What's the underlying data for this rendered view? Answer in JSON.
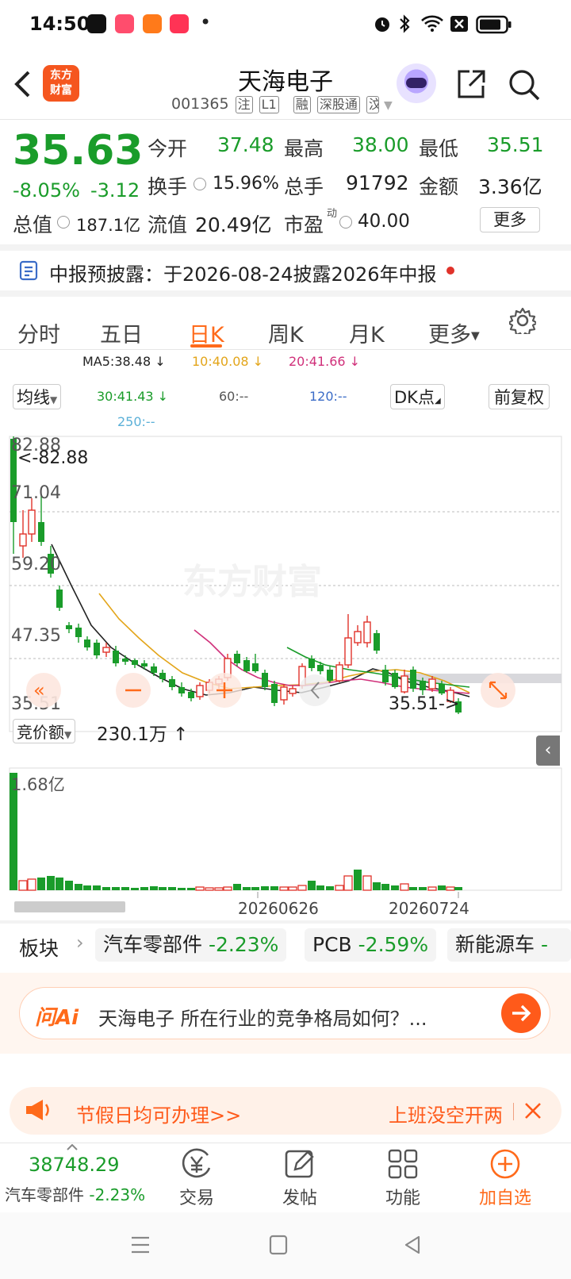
{
  "status_bar": {
    "time": "14:50",
    "dot": "•"
  },
  "header": {
    "title": "天海电子",
    "code": "001365",
    "tags": [
      "注",
      "L1",
      "融",
      "深股通",
      "汶"
    ]
  },
  "brand_logo": {
    "line1": "东方",
    "line2": "财富"
  },
  "quote": {
    "price": "35.63",
    "change_pct": "-8.05%",
    "change": "-3.12",
    "open_label": "今开",
    "open": "37.48",
    "high_label": "最高",
    "high": "38.00",
    "low_label": "最低",
    "low": "35.51",
    "turnover_label": "换手",
    "turnover": "15.96%",
    "volume_label": "总手",
    "volume": "91792",
    "amount_label": "金额",
    "amount": "3.36亿",
    "mktcap_label": "总值",
    "mktcap": "187.1亿",
    "float_label": "流值",
    "float_cap": "20.49亿",
    "pe_label": "市盈",
    "pe_sup": "动",
    "pe": "40.00",
    "more_label": "更多"
  },
  "notice": {
    "label": "中报预披露：",
    "text": "于2026-08-24披露2026年中报"
  },
  "tabs": [
    "分时",
    "五日",
    "日K",
    "周K",
    "月K",
    "更多"
  ],
  "active_tab": "日K",
  "ma_bar": {
    "ma_select": "均线",
    "ma5": "MA5:38.48 ↓",
    "ma10": "10:40.08 ↓",
    "ma20": "20:41.66 ↓",
    "ma30": "30:41.43 ↓",
    "ma60": "60:--",
    "ma120": "120:--",
    "ma250": "250:--",
    "dk_btn": "DK点",
    "fq_btn": "前复权"
  },
  "kline": {
    "y_max": "82.88",
    "y_2": "71.04",
    "y_3": "59.20",
    "y_4": "47.35",
    "y_min": "35.51",
    "max_marker": "<-82.88",
    "min_marker": "35.51->",
    "watermark": "东方财富"
  },
  "volume_panel": {
    "select": "竞价额",
    "value": "230.1万 ↑",
    "max_label": "1.68亿",
    "date1": "20260626",
    "date2": "20260724"
  },
  "sectors": {
    "label": "板块",
    "items": [
      {
        "name": "汽车零部件",
        "pct": "-2.23%"
      },
      {
        "name": "PCB",
        "pct": "-2.59%"
      },
      {
        "name": "新能源车",
        "pct": "-"
      }
    ]
  },
  "ai_bar": {
    "logo": "问Ai",
    "question": "天海电子 所在行业的竞争格局如何？..."
  },
  "banner": {
    "left": "节假日均可办理>>",
    "right": "上班没空开两"
  },
  "bottom_nav": {
    "index_value": "38748.29",
    "index_name": "汽车零部件",
    "index_pct": "-2.23%",
    "items": [
      "交易",
      "发帖",
      "功能",
      "加自选"
    ]
  },
  "colors": {
    "up": "#e0322a",
    "down": "#1a9c2a",
    "accent": "#ff6a1a"
  }
}
